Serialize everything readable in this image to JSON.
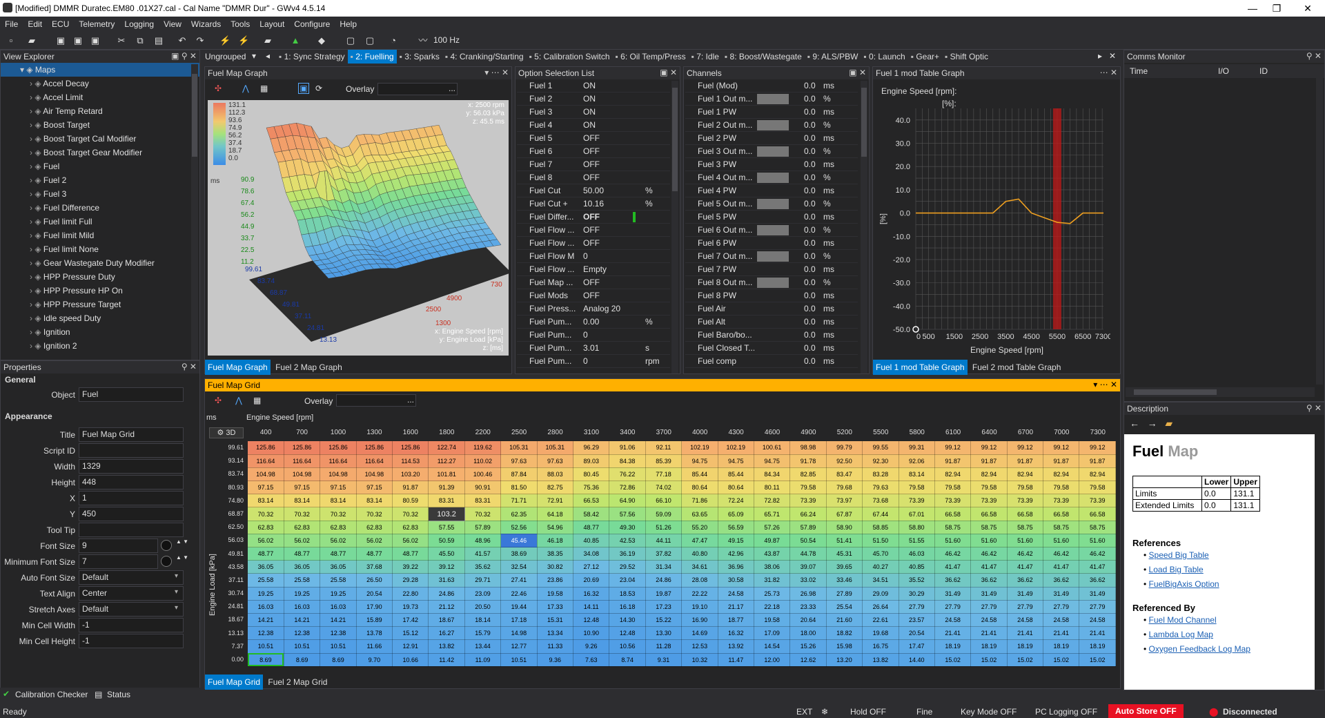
{
  "window": {
    "title": "[Modified] DMMR Duratec.EM80  .01X27.cal - Cal Name \"DMMR Dur\" - GWv4 4.5.14"
  },
  "menu": [
    "File",
    "Edit",
    "ECU",
    "Telemetry",
    "Logging",
    "View",
    "Wizards",
    "Tools",
    "Layout",
    "Configure",
    "Help"
  ],
  "toolbar": {
    "freq": "100 Hz"
  },
  "view_explorer": {
    "title": "View Explorer",
    "root": "Maps",
    "items": [
      "Accel Decay",
      "Accel Limit",
      "Air Temp Retard",
      "Boost Target",
      "Boost Target Cal Modifier",
      "Boost Target Gear Modifier",
      "Fuel",
      "Fuel 2",
      "Fuel 3",
      "Fuel Difference",
      "Fuel limit Full",
      "Fuel limit Mild",
      "Fuel limit None",
      "Gear Wastegate Duty Modifier",
      "HPP Pressure Duty",
      "HPP Pressure HP On",
      "HPP Pressure Target",
      "Idle speed Duty",
      "Ignition",
      "Ignition 2"
    ]
  },
  "properties": {
    "title": "Properties",
    "general": "General",
    "object_label": "Object",
    "object": "Fuel",
    "appearance": "Appearance",
    "fields": [
      {
        "label": "Title",
        "value": "Fuel Map Grid"
      },
      {
        "label": "Script ID",
        "value": ""
      },
      {
        "label": "Width",
        "value": "1329"
      },
      {
        "label": "Height",
        "value": "448"
      },
      {
        "label": "X",
        "value": "1"
      },
      {
        "label": "Y",
        "value": "450"
      },
      {
        "label": "Tool Tip",
        "value": ""
      },
      {
        "label": "Font Size",
        "value": "9"
      },
      {
        "label": "Minimum Font Size",
        "value": "7"
      },
      {
        "label": "Auto Font Size",
        "value": "Default"
      },
      {
        "label": "Text Align",
        "value": "Center"
      },
      {
        "label": "Stretch Axes",
        "value": "Default"
      },
      {
        "label": "Min Cell Width",
        "value": "-1"
      },
      {
        "label": "Min Cell Height",
        "value": "-1"
      }
    ]
  },
  "bottom_tabs": {
    "cal_checker": "Calibration Checker",
    "status": "Status"
  },
  "tabs": {
    "ungrouped": "Ungrouped",
    "items": [
      "1: Sync Strategy",
      "2: Fuelling",
      "3: Sparks",
      "4: Cranking/Starting",
      "5: Calibration Switch",
      "6: Oil Temp/Press",
      "7: Idle",
      "8: Boost/Wastegate",
      "9: ALS/PBW",
      "0: Launch",
      "Gear+",
      "Shift Optic"
    ],
    "active": 1
  },
  "fuel_map_graph": {
    "title": "Fuel Map Graph",
    "overlay": "Overlay",
    "readout_x": "x: 2500 rpm",
    "readout_y": "y: 56.03 kPa",
    "readout_z": "z: 45.5 ms",
    "zlabels": [
      "131.1",
      "112.3",
      "93.6",
      "74.9",
      "56.2",
      "37.4",
      "18.7",
      "0.0"
    ],
    "unit": "ms",
    "zaxis": [
      "90.9",
      "78.6",
      "67.4",
      "56.2",
      "44.9",
      "33.7",
      "22.5",
      "11.2"
    ],
    "load_axis": [
      "99.61",
      "83.74",
      "68.87",
      "49.81",
      "37.11",
      "24.81",
      "13.13"
    ],
    "rpm_axis": [
      "730",
      "4900",
      "2500",
      "1300"
    ],
    "axis_x": "x: Engine Speed [rpm]",
    "axis_y": "y: Engine Load [kPa]",
    "axis_z": "z: [ms]",
    "tabs": [
      "Fuel Map Graph",
      "Fuel 2 Map Graph"
    ]
  },
  "option_list": {
    "title": "Option Selection List",
    "rows": [
      {
        "n": "Fuel 1",
        "v": "ON",
        "u": ""
      },
      {
        "n": "Fuel 2",
        "v": "ON",
        "u": ""
      },
      {
        "n": "Fuel 3",
        "v": "ON",
        "u": ""
      },
      {
        "n": "Fuel 4",
        "v": "ON",
        "u": ""
      },
      {
        "n": "Fuel 5",
        "v": "OFF",
        "u": ""
      },
      {
        "n": "Fuel 6",
        "v": "OFF",
        "u": ""
      },
      {
        "n": "Fuel 7",
        "v": "OFF",
        "u": ""
      },
      {
        "n": "Fuel 8",
        "v": "OFF",
        "u": ""
      },
      {
        "n": "Fuel Cut",
        "v": "50.00",
        "u": "%"
      },
      {
        "n": "Fuel Cut +",
        "v": "10.16",
        "u": "%"
      },
      {
        "n": "Fuel Differ...",
        "v": "OFF",
        "u": ""
      },
      {
        "n": "Fuel Flow ...",
        "v": "OFF",
        "u": ""
      },
      {
        "n": "Fuel Flow ...",
        "v": "OFF",
        "u": ""
      },
      {
        "n": "Fuel Flow M",
        "v": "0",
        "u": ""
      },
      {
        "n": "Fuel Flow ...",
        "v": "Empty",
        "u": ""
      },
      {
        "n": "Fuel Map ...",
        "v": "OFF",
        "u": ""
      },
      {
        "n": "Fuel Mods",
        "v": "OFF",
        "u": ""
      },
      {
        "n": "Fuel Press...",
        "v": "Analog 20",
        "u": ""
      },
      {
        "n": "Fuel Pum...",
        "v": "0.00",
        "u": "%"
      },
      {
        "n": "Fuel Pum...",
        "v": "0",
        "u": ""
      },
      {
        "n": "Fuel Pum...",
        "v": "3.01",
        "u": "s"
      },
      {
        "n": "Fuel Pum...",
        "v": "0",
        "u": "rpm"
      }
    ]
  },
  "channels": {
    "title": "Channels",
    "rows": [
      {
        "n": "Fuel (Mod)",
        "v": "0.0",
        "u": "ms",
        "bar": false
      },
      {
        "n": "Fuel 1 Out m...",
        "v": "0.0",
        "u": "%",
        "bar": true
      },
      {
        "n": "Fuel 1 PW",
        "v": "0.0",
        "u": "ms",
        "bar": false
      },
      {
        "n": "Fuel 2 Out m...",
        "v": "0.0",
        "u": "%",
        "bar": true
      },
      {
        "n": "Fuel 2 PW",
        "v": "0.0",
        "u": "ms",
        "bar": false
      },
      {
        "n": "Fuel 3 Out m...",
        "v": "0.0",
        "u": "%",
        "bar": true
      },
      {
        "n": "Fuel 3 PW",
        "v": "0.0",
        "u": "ms",
        "bar": false
      },
      {
        "n": "Fuel 4 Out m...",
        "v": "0.0",
        "u": "%",
        "bar": true
      },
      {
        "n": "Fuel 4 PW",
        "v": "0.0",
        "u": "ms",
        "bar": false
      },
      {
        "n": "Fuel 5 Out m...",
        "v": "0.0",
        "u": "%",
        "bar": true
      },
      {
        "n": "Fuel 5 PW",
        "v": "0.0",
        "u": "ms",
        "bar": false
      },
      {
        "n": "Fuel 6 Out m...",
        "v": "0.0",
        "u": "%",
        "bar": true
      },
      {
        "n": "Fuel 6 PW",
        "v": "0.0",
        "u": "ms",
        "bar": false
      },
      {
        "n": "Fuel 7 Out m...",
        "v": "0.0",
        "u": "%",
        "bar": true
      },
      {
        "n": "Fuel 7 PW",
        "v": "0.0",
        "u": "ms",
        "bar": false
      },
      {
        "n": "Fuel 8 Out m...",
        "v": "0.0",
        "u": "%",
        "bar": true
      },
      {
        "n": "Fuel 8 PW",
        "v": "0.0",
        "u": "ms",
        "bar": false
      },
      {
        "n": "Fuel Air",
        "v": "0.0",
        "u": "ms",
        "bar": false
      },
      {
        "n": "Fuel Alt",
        "v": "0.0",
        "u": "ms",
        "bar": false
      },
      {
        "n": "Fuel Baro/bo...",
        "v": "0.0",
        "u": "ms",
        "bar": false
      },
      {
        "n": "Fuel Closed T...",
        "v": "0.0",
        "u": "ms",
        "bar": false
      },
      {
        "n": "Fuel comp",
        "v": "0.0",
        "u": "ms",
        "bar": false
      }
    ]
  },
  "mod_graph": {
    "title": "Fuel 1 mod Table Graph",
    "subtitle": "Engine Speed [rpm]:",
    "subtitle2": "[%]:",
    "ylabel": "[%]",
    "xlabel": "Engine Speed [rpm]",
    "tabs": [
      "Fuel 1 mod Table Graph",
      "Fuel 2 mod Table Graph"
    ]
  },
  "chart_data": {
    "type": "line",
    "title": "Fuel 1 mod Table Graph",
    "xlabel": "Engine Speed [rpm]",
    "ylabel": "[%]",
    "x": [
      0,
      500,
      1500,
      2500,
      3500,
      4500,
      5500,
      6500,
      7300
    ],
    "xticks": [
      "0",
      "500",
      "1500",
      "2500",
      "3500",
      "4500",
      "5500",
      "6500",
      "7300"
    ],
    "yticks": [
      "40.0",
      "30.0",
      "20.0",
      "10.0",
      "0.0",
      "-10.0",
      "-20.0",
      "-30.0",
      "-40.0",
      "-50.0"
    ],
    "ylim": [
      -50,
      45
    ],
    "series": [
      {
        "values": [
          0,
          0,
          0,
          0,
          0,
          0,
          0,
          0,
          0
        ]
      }
    ],
    "line_x": [
      0,
      500,
      1500,
      2500,
      3000,
      3500,
      4000,
      4500,
      5000,
      5500,
      6000,
      6500,
      7000,
      7300
    ],
    "line_y": [
      0,
      0,
      0,
      0,
      0,
      5,
      6,
      0,
      -2,
      -4,
      -4.5,
      0,
      0,
      0
    ],
    "cursor_x": 5500
  },
  "comms": {
    "title": "Comms Monitor",
    "cols": [
      "Time",
      "I/O",
      "ID"
    ]
  },
  "description": {
    "title": "Description",
    "heading_bold": "Fuel",
    "heading_light": "Map",
    "table_head": [
      "",
      "Lower",
      "Upper"
    ],
    "limits": {
      "label": "Limits",
      "lower": "0.0",
      "upper": "131.1"
    },
    "ext_limits": {
      "label": "Extended Limits",
      "lower": "0.0",
      "upper": "131.1"
    },
    "references_title": "References",
    "references": [
      "Speed Big Table",
      "Load Big Table",
      "FuelBigAxis Option"
    ],
    "referenced_by_title": "Referenced By",
    "referenced_by": [
      "Fuel Mod Channel",
      "Lambda Log Map",
      "Oxygen Feedback Log Map"
    ]
  },
  "grid": {
    "title": "Fuel Map Grid",
    "overlay": "Overlay",
    "unit": "ms",
    "xaxis_label": "Engine Speed [rpm]",
    "yaxis_label": "Engine Load [kPa]",
    "btn3d": "3D",
    "popup": "103.2",
    "tabs": [
      "Fuel Map Grid",
      "Fuel 2 Map Grid"
    ],
    "rpm": [
      "400",
      "700",
      "1000",
      "1300",
      "1600",
      "1800",
      "2200",
      "2500",
      "2800",
      "3100",
      "3400",
      "3700",
      "4000",
      "4300",
      "4600",
      "4900",
      "5200",
      "5500",
      "5800",
      "6100",
      "6400",
      "6700",
      "7000",
      "7300"
    ],
    "load": [
      "99.61",
      "93.14",
      "83.74",
      "80.93",
      "74.80",
      "68.87",
      "62.50",
      "56.03",
      "49.81",
      "43.58",
      "37.11",
      "30.74",
      "24.81",
      "18.67",
      "13.13",
      "7.37",
      "0.00"
    ],
    "rows": [
      [
        "125.86",
        "125.86",
        "125.86",
        "125.86",
        "125.86",
        "122.74",
        "119.62",
        "105.31",
        "105.31",
        "96.29",
        "91.06",
        "92.11",
        "102.19",
        "102.19",
        "100.61",
        "98.98",
        "99.79",
        "99.55",
        "99.31",
        "99.12",
        "99.12",
        "99.12",
        "99.12",
        "99.12"
      ],
      [
        "116.64",
        "116.64",
        "116.64",
        "116.64",
        "114.53",
        "112.27",
        "110.02",
        "97.63",
        "97.63",
        "89.03",
        "84.38",
        "85.39",
        "94.75",
        "94.75",
        "94.75",
        "91.78",
        "92.50",
        "92.30",
        "92.06",
        "91.87",
        "91.87",
        "91.87",
        "91.87",
        "91.87"
      ],
      [
        "104.98",
        "104.98",
        "104.98",
        "104.98",
        "103.20",
        "101.81",
        "100.46",
        "87.84",
        "88.03",
        "80.45",
        "76.22",
        "77.18",
        "85.44",
        "85.44",
        "84.34",
        "82.85",
        "83.47",
        "83.28",
        "83.14",
        "82.94",
        "82.94",
        "82.94",
        "82.94",
        "82.94"
      ],
      [
        "97.15",
        "97.15",
        "97.15",
        "97.15",
        "91.87",
        "91.39",
        "90.91",
        "81.50",
        "82.75",
        "75.36",
        "72.86",
        "74.02",
        "80.64",
        "80.64",
        "80.11",
        "79.58",
        "79.68",
        "79.63",
        "79.58",
        "79.58",
        "79.58",
        "79.58",
        "79.58",
        "79.58"
      ],
      [
        "83.14",
        "83.14",
        "83.14",
        "83.14",
        "80.59",
        "83.31",
        "83.31",
        "71.71",
        "72.91",
        "66.53",
        "64.90",
        "66.10",
        "71.86",
        "72.24",
        "72.82",
        "73.39",
        "73.97",
        "73.68",
        "73.39",
        "73.39",
        "73.39",
        "73.39",
        "73.39",
        "73.39"
      ],
      [
        "70.32",
        "70.32",
        "70.32",
        "70.32",
        "70.32",
        "103.2",
        "70.32",
        "62.35",
        "64.18",
        "58.42",
        "57.56",
        "59.09",
        "63.65",
        "65.09",
        "65.71",
        "66.24",
        "67.87",
        "67.44",
        "67.01",
        "66.58",
        "66.58",
        "66.58",
        "66.58",
        "66.58"
      ],
      [
        "62.83",
        "62.83",
        "62.83",
        "62.83",
        "62.83",
        "57.55",
        "57.89",
        "52.56",
        "54.96",
        "48.77",
        "49.30",
        "51.26",
        "55.20",
        "56.59",
        "57.26",
        "57.89",
        "58.90",
        "58.85",
        "58.80",
        "58.75",
        "58.75",
        "58.75",
        "58.75",
        "58.75"
      ],
      [
        "56.02",
        "56.02",
        "56.02",
        "56.02",
        "56.02",
        "50.59",
        "48.96",
        "45.46",
        "46.18",
        "40.85",
        "42.53",
        "44.11",
        "47.47",
        "49.15",
        "49.87",
        "50.54",
        "51.41",
        "51.50",
        "51.55",
        "51.60",
        "51.60",
        "51.60",
        "51.60",
        "51.60"
      ],
      [
        "48.77",
        "48.77",
        "48.77",
        "48.77",
        "48.77",
        "45.50",
        "41.57",
        "38.69",
        "38.35",
        "34.08",
        "36.19",
        "37.82",
        "40.80",
        "42.96",
        "43.87",
        "44.78",
        "45.31",
        "45.70",
        "46.03",
        "46.42",
        "46.42",
        "46.42",
        "46.42",
        "46.42"
      ],
      [
        "36.05",
        "36.05",
        "36.05",
        "37.68",
        "39.22",
        "39.12",
        "35.62",
        "32.54",
        "30.82",
        "27.12",
        "29.52",
        "31.34",
        "34.61",
        "36.96",
        "38.06",
        "39.07",
        "39.65",
        "40.27",
        "40.85",
        "41.47",
        "41.47",
        "41.47",
        "41.47",
        "41.47"
      ],
      [
        "25.58",
        "25.58",
        "25.58",
        "26.50",
        "29.28",
        "31.63",
        "29.71",
        "27.41",
        "23.86",
        "20.69",
        "23.04",
        "24.86",
        "28.08",
        "30.58",
        "31.82",
        "33.02",
        "33.46",
        "34.51",
        "35.52",
        "36.62",
        "36.62",
        "36.62",
        "36.62",
        "36.62"
      ],
      [
        "19.25",
        "19.25",
        "19.25",
        "20.54",
        "22.80",
        "24.86",
        "23.09",
        "22.46",
        "19.58",
        "16.32",
        "18.53",
        "19.87",
        "22.22",
        "24.58",
        "25.73",
        "26.98",
        "27.89",
        "29.09",
        "30.29",
        "31.49",
        "31.49",
        "31.49",
        "31.49",
        "31.49"
      ],
      [
        "16.03",
        "16.03",
        "16.03",
        "17.90",
        "19.73",
        "21.12",
        "20.50",
        "19.44",
        "17.33",
        "14.11",
        "16.18",
        "17.23",
        "19.10",
        "21.17",
        "22.18",
        "23.33",
        "25.54",
        "26.64",
        "27.79",
        "27.79",
        "27.79",
        "27.79",
        "27.79",
        "27.79"
      ],
      [
        "14.21",
        "14.21",
        "14.21",
        "15.89",
        "17.42",
        "18.67",
        "18.14",
        "17.18",
        "15.31",
        "12.48",
        "14.30",
        "15.22",
        "16.90",
        "18.77",
        "19.58",
        "20.64",
        "21.60",
        "22.61",
        "23.57",
        "24.58",
        "24.58",
        "24.58",
        "24.58",
        "24.58"
      ],
      [
        "12.38",
        "12.38",
        "12.38",
        "13.78",
        "15.12",
        "16.27",
        "15.79",
        "14.98",
        "13.34",
        "10.90",
        "12.48",
        "13.30",
        "14.69",
        "16.32",
        "17.09",
        "18.00",
        "18.82",
        "19.68",
        "20.54",
        "21.41",
        "21.41",
        "21.41",
        "21.41",
        "21.41"
      ],
      [
        "10.51",
        "10.51",
        "10.51",
        "11.66",
        "12.91",
        "13.82",
        "13.44",
        "12.77",
        "11.33",
        "9.26",
        "10.56",
        "11.28",
        "12.53",
        "13.92",
        "14.54",
        "15.26",
        "15.98",
        "16.75",
        "17.47",
        "18.19",
        "18.19",
        "18.19",
        "18.19",
        "18.19"
      ],
      [
        "8.69",
        "8.69",
        "8.69",
        "9.70",
        "10.66",
        "11.42",
        "11.09",
        "10.51",
        "9.36",
        "7.63",
        "8.74",
        "9.31",
        "10.32",
        "11.47",
        "12.00",
        "12.62",
        "13.20",
        "13.82",
        "14.40",
        "15.02",
        "15.02",
        "15.02",
        "15.02",
        "15.02"
      ]
    ]
  },
  "statusbar": {
    "ready": "Ready",
    "ext": "EXT",
    "hold": "Hold OFF",
    "fine": "Fine",
    "keymode": "Key Mode OFF",
    "pclog": "PC Logging OFF",
    "autostore": "Auto Store OFF",
    "conn": "Disconnected"
  },
  "colors": {
    "accent": "#007acc",
    "selected": "#1c5a94",
    "autostore_bg": "#e81123",
    "grid_title": "#ffb000",
    "line": "#f0a020",
    "cursor": "#ff3030"
  }
}
